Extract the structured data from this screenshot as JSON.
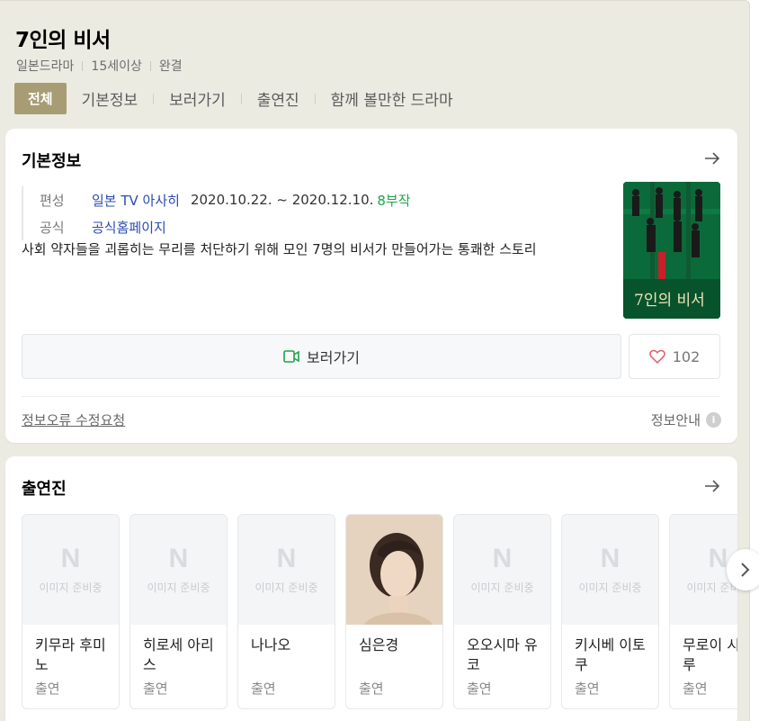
{
  "header": {
    "title": "7인의 비서",
    "meta": [
      "일본드라마",
      "15세이상",
      "완결"
    ],
    "tabs": [
      "전체",
      "기본정보",
      "보러가기",
      "출연진",
      "함께 볼만한 드라마"
    ]
  },
  "basic_info": {
    "title": "기본정보",
    "network_key": "편성",
    "network_value": "일본 TV 아사히",
    "dates": "2020.10.22. ~ 2020.12.10.",
    "episodes": "8부작",
    "official_key": "공식",
    "official_value": "공식홈페이지",
    "synopsis": "사회 약자들을 괴롭히는 무리를 처단하기 위해 모인 7명의 비서가 만들어가는 통쾌한 스토리",
    "poster_text": "7인의 비서",
    "watch_label": "보러가기",
    "likes": "102",
    "report_label": "정보오류 수정요청",
    "guide_label": "정보안내",
    "guide_icon": "i"
  },
  "cast": {
    "title": "출연진",
    "placeholder_logo": "N",
    "placeholder_text": "이미지 준비중",
    "members": [
      {
        "name": "키무라 후미노",
        "role": "출연",
        "has_photo": false
      },
      {
        "name": "히로세 아리스",
        "role": "출연",
        "has_photo": false
      },
      {
        "name": "나나오",
        "role": "출연",
        "has_photo": false
      },
      {
        "name": "심은경",
        "role": "출연",
        "has_photo": true
      },
      {
        "name": "오오시마 유코",
        "role": "출연",
        "has_photo": false
      },
      {
        "name": "키시베 이토쿠",
        "role": "출연",
        "has_photo": false
      },
      {
        "name": "무로이 시게루",
        "role": "출연",
        "has_photo": false
      }
    ]
  },
  "colors": {
    "background": "#ecebe2",
    "active_tab": "#a79c73",
    "link": "#2b4cb0",
    "episodes": "#1fa34a",
    "watch_icon": "#1fa34a",
    "heart": "#e05a6a"
  }
}
